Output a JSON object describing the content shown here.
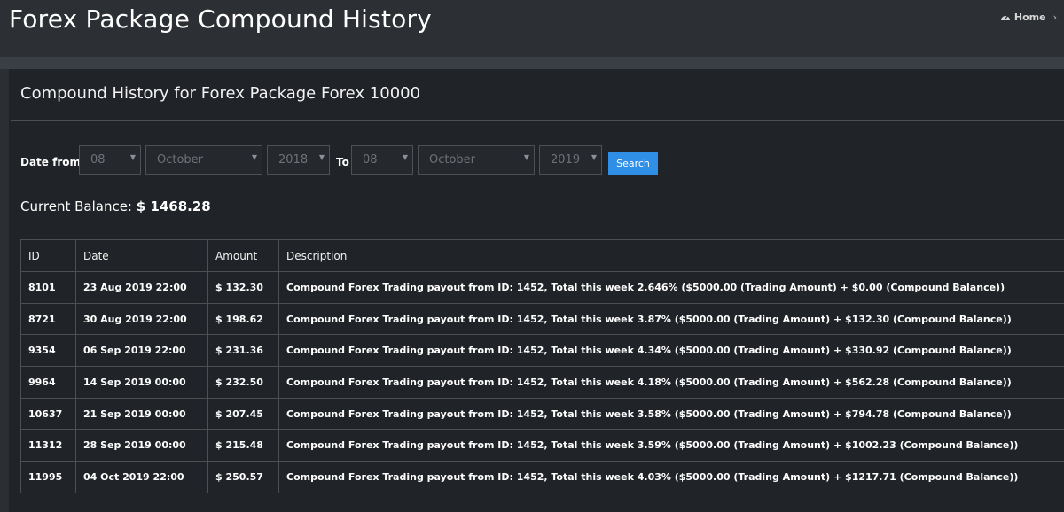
{
  "header": {
    "title": "Forex Package Compound History",
    "breadcrumb": {
      "home_label": "Home",
      "chevron": "›"
    }
  },
  "panel": {
    "title": "Compound History for Forex Package Forex 10000"
  },
  "filter": {
    "date_from_label": "Date from",
    "to_label": "To",
    "from_day": "08",
    "from_month": "October",
    "from_year": "2018",
    "to_day": "08",
    "to_month": "October",
    "to_year": "2019",
    "search_label": "Search"
  },
  "balance": {
    "label": "Current Balance:",
    "value": "$ 1468.28"
  },
  "table": {
    "headers": [
      "ID",
      "Date",
      "Amount",
      "Description"
    ],
    "rows": [
      {
        "id": "8101",
        "date": "23 Aug 2019 22:00",
        "amount": "$ 132.30",
        "description": "Compound Forex Trading payout from ID: 1452, Total this week 2.646% ($5000.00 (Trading Amount) + $0.00 (Compound Balance))"
      },
      {
        "id": "8721",
        "date": "30 Aug 2019 22:00",
        "amount": "$ 198.62",
        "description": "Compound Forex Trading payout from ID: 1452, Total this week 3.87% ($5000.00 (Trading Amount) + $132.30 (Compound Balance))"
      },
      {
        "id": "9354",
        "date": "06 Sep 2019 22:00",
        "amount": "$ 231.36",
        "description": "Compound Forex Trading payout from ID: 1452, Total this week 4.34% ($5000.00 (Trading Amount) + $330.92 (Compound Balance))"
      },
      {
        "id": "9964",
        "date": "14 Sep 2019 00:00",
        "amount": "$ 232.50",
        "description": "Compound Forex Trading payout from ID: 1452, Total this week 4.18% ($5000.00 (Trading Amount) + $562.28 (Compound Balance))"
      },
      {
        "id": "10637",
        "date": "21 Sep 2019 00:00",
        "amount": "$ 207.45",
        "description": "Compound Forex Trading payout from ID: 1452, Total this week 3.58% ($5000.00 (Trading Amount) + $794.78 (Compound Balance))"
      },
      {
        "id": "11312",
        "date": "28 Sep 2019 00:00",
        "amount": "$ 215.48",
        "description": "Compound Forex Trading payout from ID: 1452, Total this week 3.59% ($5000.00 (Trading Amount) + $1002.23 (Compound Balance))"
      },
      {
        "id": "11995",
        "date": "04 Oct 2019 22:00",
        "amount": "$ 250.57",
        "description": "Compound Forex Trading payout from ID: 1452, Total this week 4.03% ($5000.00 (Trading Amount) + $1217.71 (Compound Balance))"
      }
    ]
  },
  "colors": {
    "background": "#2b2e33",
    "panel": "#202328",
    "accent": "#2f8ee6",
    "border": "#4b4f56"
  },
  "icons": {
    "home": "dashboard-gauge-icon",
    "select_arrow": "caret-down-icon"
  }
}
